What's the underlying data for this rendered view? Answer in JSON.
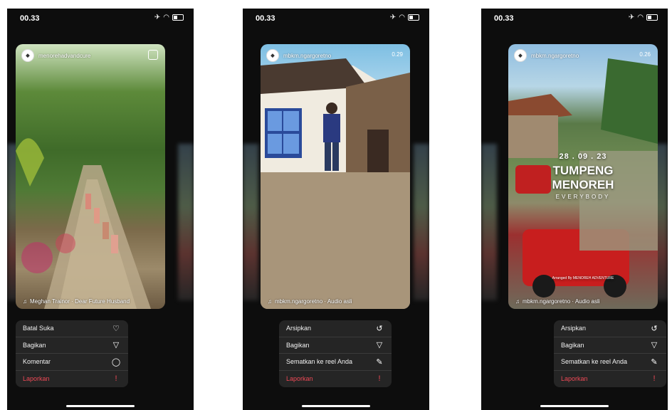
{
  "phones": [
    {
      "status_time": "00.33",
      "username": "menorehadvandcure",
      "audio": "Meghan Trainor · Dear Future Husband",
      "menu": [
        {
          "label": "Batal Suka",
          "icon": "heart-slash-icon",
          "glyph": "♡"
        },
        {
          "label": "Bagikan",
          "icon": "send-icon",
          "glyph": "▽"
        },
        {
          "label": "Komentar",
          "icon": "comment-icon",
          "glyph": "◯"
        },
        {
          "label": "Laporkan",
          "icon": "report-icon",
          "glyph": "!"
        }
      ]
    },
    {
      "status_time": "00.33",
      "username": "mbkm.ngargoretno",
      "timer": "0.29",
      "audio": "mbkm.ngargoretno · Audio asli",
      "menu": [
        {
          "label": "Arsipkan",
          "icon": "archive-icon",
          "glyph": "↺"
        },
        {
          "label": "Bagikan",
          "icon": "send-icon",
          "glyph": "▽"
        },
        {
          "label": "Sematkan ke reel Anda",
          "icon": "pin-icon",
          "glyph": "✎"
        },
        {
          "label": "Laporkan",
          "icon": "report-icon",
          "glyph": "!"
        }
      ]
    },
    {
      "status_time": "00.33",
      "username": "mbkm.ngargoretno",
      "timer": "0.26",
      "audio": "mbkm.ngargoretno · Audio asli",
      "overlay": {
        "date": "28 . 09 . 23",
        "title_line1": "TUMPENG",
        "title_line2": "MENOREH",
        "subtitle": "EVERYBODY",
        "credit": "Arranged By MENOREH ADVENTURE"
      },
      "menu": [
        {
          "label": "Arsipkan",
          "icon": "archive-icon",
          "glyph": "↺"
        },
        {
          "label": "Bagikan",
          "icon": "send-icon",
          "glyph": "▽"
        },
        {
          "label": "Sematkan ke reel Anda",
          "icon": "pin-icon",
          "glyph": "✎"
        },
        {
          "label": "Laporkan",
          "icon": "report-icon",
          "glyph": "!"
        }
      ]
    }
  ],
  "colors": {
    "danger": "#ed4956",
    "menu_bg": "#262626",
    "phone_bg": "#0d0d0d"
  }
}
